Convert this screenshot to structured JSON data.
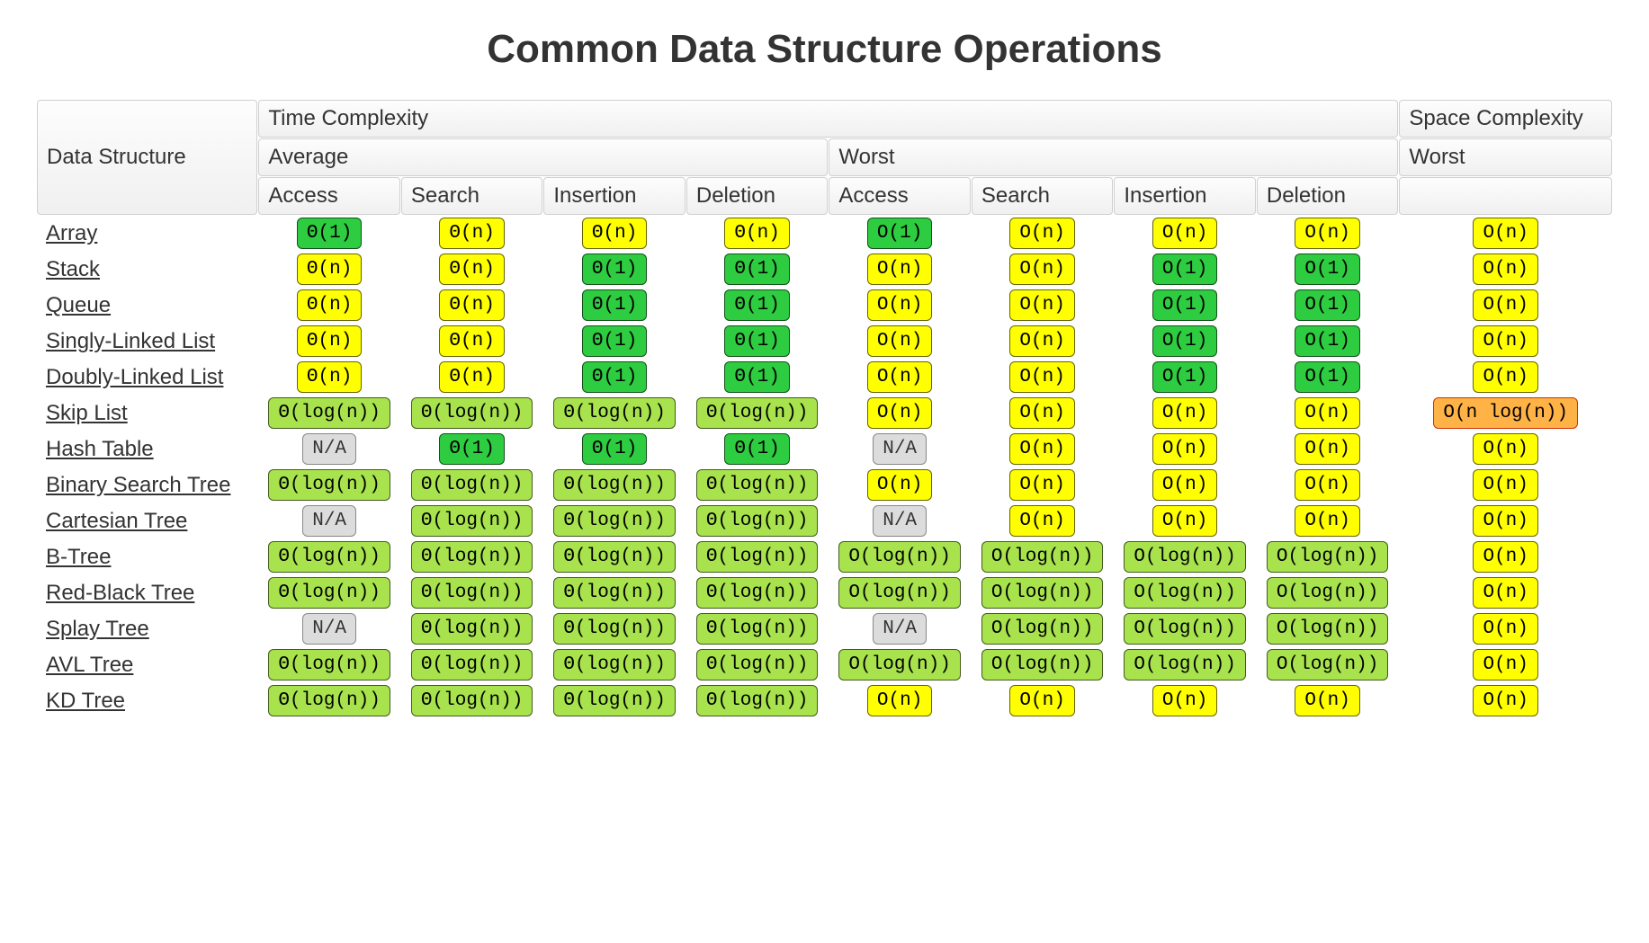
{
  "title": "Common Data Structure Operations",
  "headers": {
    "data_structure": "Data Structure",
    "time_complexity": "Time Complexity",
    "space_complexity": "Space Complexity",
    "average": "Average",
    "worst": "Worst",
    "ops": [
      "Access",
      "Search",
      "Insertion",
      "Deletion"
    ]
  },
  "complexity_labels": {
    "O1": "Θ(1)",
    "O1w": "O(1)",
    "On": "Θ(n)",
    "Onw": "O(n)",
    "Olog": "Θ(log(n))",
    "Ologw": "O(log(n))",
    "Onlog": "O(n log(n))",
    "NA": "N/A"
  },
  "color_map": {
    "O1": "c-green",
    "O1w": "c-green",
    "On": "c-yellow",
    "Onw": "c-yellow",
    "Olog": "c-lime",
    "Ologw": "c-lime",
    "Onlog": "c-orange",
    "NA": "c-grey"
  },
  "chart_data": {
    "type": "table",
    "title": "Common Data Structure Operations",
    "columns": [
      "Data Structure",
      "Avg Access",
      "Avg Search",
      "Avg Insertion",
      "Avg Deletion",
      "Worst Access",
      "Worst Search",
      "Worst Insertion",
      "Worst Deletion",
      "Space Worst"
    ],
    "rows": [
      {
        "name": "Array",
        "avg": [
          "O1",
          "On",
          "On",
          "On"
        ],
        "worst": [
          "O1w",
          "Onw",
          "Onw",
          "Onw"
        ],
        "space": "Onw"
      },
      {
        "name": "Stack",
        "avg": [
          "On",
          "On",
          "O1",
          "O1"
        ],
        "worst": [
          "Onw",
          "Onw",
          "O1w",
          "O1w"
        ],
        "space": "Onw"
      },
      {
        "name": "Queue",
        "avg": [
          "On",
          "On",
          "O1",
          "O1"
        ],
        "worst": [
          "Onw",
          "Onw",
          "O1w",
          "O1w"
        ],
        "space": "Onw"
      },
      {
        "name": "Singly-Linked List",
        "avg": [
          "On",
          "On",
          "O1",
          "O1"
        ],
        "worst": [
          "Onw",
          "Onw",
          "O1w",
          "O1w"
        ],
        "space": "Onw"
      },
      {
        "name": "Doubly-Linked List",
        "avg": [
          "On",
          "On",
          "O1",
          "O1"
        ],
        "worst": [
          "Onw",
          "Onw",
          "O1w",
          "O1w"
        ],
        "space": "Onw"
      },
      {
        "name": "Skip List",
        "avg": [
          "Olog",
          "Olog",
          "Olog",
          "Olog"
        ],
        "worst": [
          "Onw",
          "Onw",
          "Onw",
          "Onw"
        ],
        "space": "Onlog"
      },
      {
        "name": "Hash Table",
        "avg": [
          "NA",
          "O1",
          "O1",
          "O1"
        ],
        "worst": [
          "NA",
          "Onw",
          "Onw",
          "Onw"
        ],
        "space": "Onw"
      },
      {
        "name": "Binary Search Tree",
        "avg": [
          "Olog",
          "Olog",
          "Olog",
          "Olog"
        ],
        "worst": [
          "Onw",
          "Onw",
          "Onw",
          "Onw"
        ],
        "space": "Onw"
      },
      {
        "name": "Cartesian Tree",
        "avg": [
          "NA",
          "Olog",
          "Olog",
          "Olog"
        ],
        "worst": [
          "NA",
          "Onw",
          "Onw",
          "Onw"
        ],
        "space": "Onw"
      },
      {
        "name": "B-Tree",
        "avg": [
          "Olog",
          "Olog",
          "Olog",
          "Olog"
        ],
        "worst": [
          "Ologw",
          "Ologw",
          "Ologw",
          "Ologw"
        ],
        "space": "Onw"
      },
      {
        "name": "Red-Black Tree",
        "avg": [
          "Olog",
          "Olog",
          "Olog",
          "Olog"
        ],
        "worst": [
          "Ologw",
          "Ologw",
          "Ologw",
          "Ologw"
        ],
        "space": "Onw"
      },
      {
        "name": "Splay Tree",
        "avg": [
          "NA",
          "Olog",
          "Olog",
          "Olog"
        ],
        "worst": [
          "NA",
          "Ologw",
          "Ologw",
          "Ologw"
        ],
        "space": "Onw"
      },
      {
        "name": "AVL Tree",
        "avg": [
          "Olog",
          "Olog",
          "Olog",
          "Olog"
        ],
        "worst": [
          "Ologw",
          "Ologw",
          "Ologw",
          "Ologw"
        ],
        "space": "Onw"
      },
      {
        "name": "KD Tree",
        "avg": [
          "Olog",
          "Olog",
          "Olog",
          "Olog"
        ],
        "worst": [
          "Onw",
          "Onw",
          "Onw",
          "Onw"
        ],
        "space": "Onw"
      }
    ]
  }
}
